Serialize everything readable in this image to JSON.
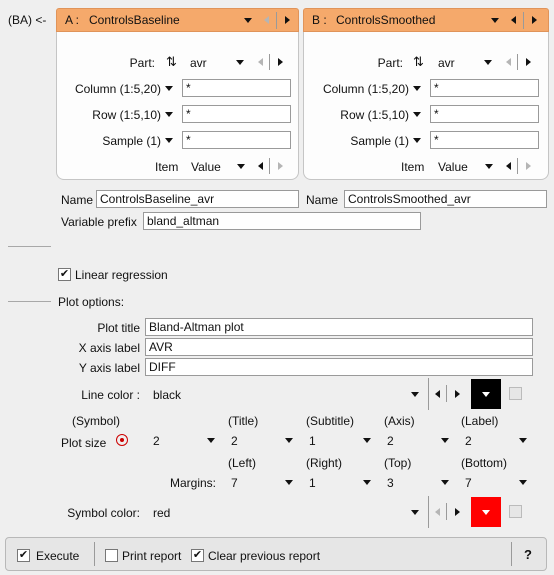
{
  "header": {
    "ba_label": "(BA) <-"
  },
  "panel_a": {
    "letter": "A :",
    "title": "ControlsBaseline",
    "part_label": "Part:",
    "part_value": "avr",
    "column_label": "Column (1:5,20)",
    "column_value": "*",
    "row_label": "Row (1:5,10)",
    "row_value": "*",
    "sample_label": "Sample (1)",
    "sample_value": "*",
    "item_label": "Item",
    "item_value": "Value",
    "name_label": "Name",
    "name_value": "ControlsBaseline_avr"
  },
  "panel_b": {
    "letter": "B :",
    "title": "ControlsSmoothed",
    "part_label": "Part:",
    "part_value": "avr",
    "column_label": "Column (1:5,20)",
    "column_value": "*",
    "row_label": "Row (1:5,10)",
    "row_value": "*",
    "sample_label": "Sample (1)",
    "sample_value": "*",
    "item_label": "Item",
    "item_value": "Value",
    "name_label": "Name",
    "name_value": "ControlsSmoothed_avr"
  },
  "variable_prefix": {
    "label": "Variable prefix",
    "value": "bland_altman"
  },
  "linear_regression": {
    "label": "Linear regression",
    "checked": true
  },
  "plot_options": {
    "section_label": "Plot options:",
    "plot_title_label": "Plot title",
    "plot_title_value": "Bland-Altman plot",
    "x_axis_label": "X axis label",
    "x_axis_value": "AVR",
    "y_axis_label": "Y axis label",
    "y_axis_value": "DIFF",
    "line_color_label": "Line color :",
    "line_color_value": "black",
    "line_color_hex": "#000000",
    "plot_size_label": "Plot size",
    "size_headers": [
      "(Symbol)",
      "(Title)",
      "(Subtitle)",
      "(Axis)",
      "(Label)"
    ],
    "size_values": [
      "2",
      "2",
      "1",
      "2",
      "2"
    ],
    "margins_label": "Margins:",
    "margin_headers": [
      "(Left)",
      "(Right)",
      "(Top)",
      "(Bottom)"
    ],
    "margin_values": [
      "7",
      "1",
      "3",
      "7"
    ],
    "symbol_color_label": "Symbol color:",
    "symbol_color_value": "red",
    "symbol_color_hex": "#ff0000"
  },
  "bottom_bar": {
    "execute_label": "Execute",
    "execute_checked": true,
    "print_report_label": "Print report",
    "print_report_checked": false,
    "clear_report_label": "Clear previous report",
    "clear_report_checked": true,
    "help_label": "?"
  }
}
